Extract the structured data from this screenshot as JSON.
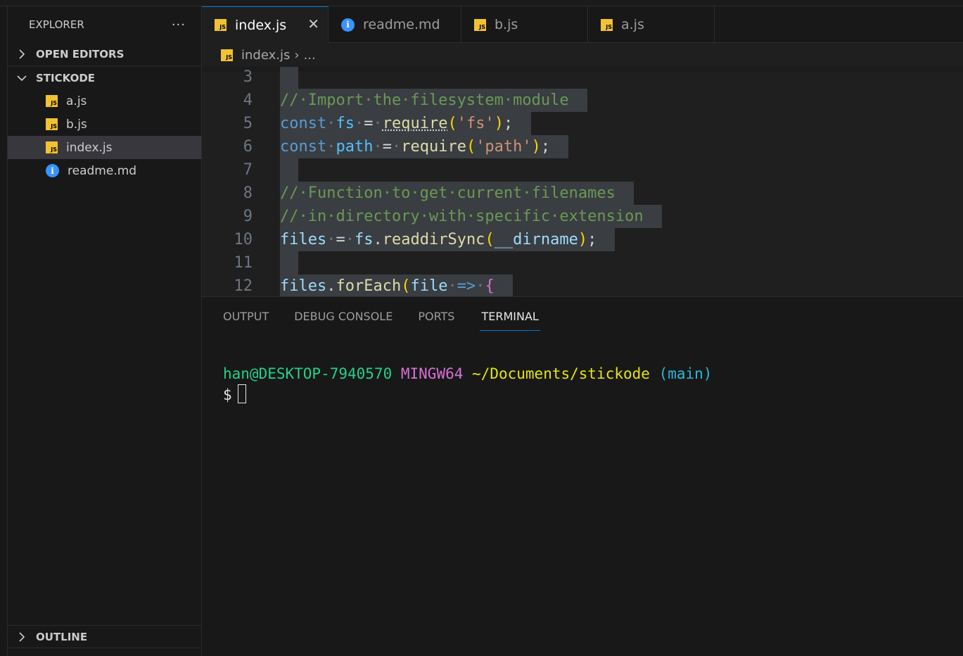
{
  "sidebar": {
    "title": "EXPLORER",
    "more": "···",
    "open_editors": "OPEN EDITORS",
    "project": "STICKODE",
    "files": [
      {
        "name": "a.js",
        "icon": "js-file-icon"
      },
      {
        "name": "b.js",
        "icon": "js-file-icon"
      },
      {
        "name": "index.js",
        "icon": "js-file-icon",
        "active": true
      },
      {
        "name": "readme.md",
        "icon": "info-icon"
      }
    ],
    "outline": "OUTLINE"
  },
  "tabs": [
    {
      "label": "index.js",
      "icon": "js-file-icon",
      "active": true,
      "close": "✕"
    },
    {
      "label": "readme.md",
      "icon": "info-icon"
    },
    {
      "label": "b.js",
      "icon": "js-file-icon"
    },
    {
      "label": "a.js",
      "icon": "js-file-icon"
    }
  ],
  "breadcrumb": {
    "file": "index.js",
    "sep": "›",
    "more": "..."
  },
  "editor": {
    "lines": [
      {
        "n": "3",
        "tokens": []
      },
      {
        "n": "4",
        "tokens": [
          {
            "t": "//·Import·the·filesystem·module",
            "c": "c-com"
          }
        ]
      },
      {
        "n": "5",
        "tokens": [
          {
            "t": "const",
            "c": "c-kw"
          },
          {
            "t": "·",
            "c": "c-ws"
          },
          {
            "t": "fs",
            "c": "c-const"
          },
          {
            "t": "·",
            "c": "c-ws"
          },
          {
            "t": "=",
            "c": ""
          },
          {
            "t": "·",
            "c": "c-ws"
          },
          {
            "t": "require",
            "c": "c-fn dotted"
          },
          {
            "t": "(",
            "c": "c-br1"
          },
          {
            "t": "'fs'",
            "c": "c-str"
          },
          {
            "t": ")",
            "c": "c-br1"
          },
          {
            "t": ";",
            "c": ""
          }
        ]
      },
      {
        "n": "6",
        "tokens": [
          {
            "t": "const",
            "c": "c-kw"
          },
          {
            "t": "·",
            "c": "c-ws"
          },
          {
            "t": "path",
            "c": "c-const"
          },
          {
            "t": "·",
            "c": "c-ws"
          },
          {
            "t": "=",
            "c": ""
          },
          {
            "t": "·",
            "c": "c-ws"
          },
          {
            "t": "require",
            "c": "c-fn"
          },
          {
            "t": "(",
            "c": "c-br1"
          },
          {
            "t": "'path'",
            "c": "c-str"
          },
          {
            "t": ")",
            "c": "c-br1"
          },
          {
            "t": ";",
            "c": ""
          }
        ]
      },
      {
        "n": "7",
        "tokens": []
      },
      {
        "n": "8",
        "tokens": [
          {
            "t": "//·Function·to·get·current·filenames",
            "c": "c-com"
          }
        ]
      },
      {
        "n": "9",
        "tokens": [
          {
            "t": "//·in·directory·with·specific·extension",
            "c": "c-com"
          }
        ]
      },
      {
        "n": "10",
        "tokens": [
          {
            "t": "files",
            "c": "c-var"
          },
          {
            "t": "·",
            "c": "c-ws"
          },
          {
            "t": "=",
            "c": ""
          },
          {
            "t": "·",
            "c": "c-ws"
          },
          {
            "t": "fs",
            "c": "c-var"
          },
          {
            "t": ".",
            "c": ""
          },
          {
            "t": "readdirSync",
            "c": "c-fn"
          },
          {
            "t": "(",
            "c": "c-br1"
          },
          {
            "t": "__dirname",
            "c": "c-var"
          },
          {
            "t": ")",
            "c": "c-br1"
          },
          {
            "t": ";",
            "c": ""
          }
        ]
      },
      {
        "n": "11",
        "tokens": []
      },
      {
        "n": "12",
        "tokens": [
          {
            "t": "files",
            "c": "c-var"
          },
          {
            "t": ".",
            "c": ""
          },
          {
            "t": "forEach",
            "c": "c-fn"
          },
          {
            "t": "(",
            "c": "c-br1"
          },
          {
            "t": "file",
            "c": "c-var"
          },
          {
            "t": "·",
            "c": "c-ws"
          },
          {
            "t": "=>",
            "c": "c-kw"
          },
          {
            "t": "·",
            "c": "c-ws"
          },
          {
            "t": "{",
            "c": "c-br2"
          }
        ]
      }
    ]
  },
  "panel": {
    "tabs": [
      {
        "label": "OUTPUT"
      },
      {
        "label": "DEBUG CONSOLE"
      },
      {
        "label": "PORTS"
      },
      {
        "label": "TERMINAL",
        "active": true
      }
    ],
    "terminal": {
      "user": "han@DESKTOP-7940570",
      "shell": "MINGW64",
      "path": "~/Documents/stickode",
      "branch": "(main)",
      "prompt": "$"
    }
  },
  "colors": {
    "accent": "#0078d4",
    "js_icon": "#f1c232",
    "info_icon": "#3794ff"
  }
}
